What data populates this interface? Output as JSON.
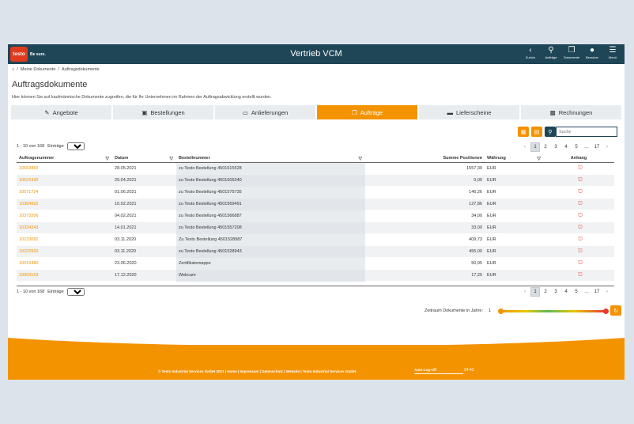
{
  "header": {
    "logo_text": "testo",
    "logo_tagline": "Be sure.",
    "title": "Vertrieb VCM",
    "actions": [
      {
        "label": "Zurück",
        "icon": "chevron-left-icon"
      },
      {
        "label": "Aufträge",
        "icon": "map-pin-icon"
      },
      {
        "label": "Dokumente",
        "icon": "documents-icon"
      },
      {
        "label": "Benutzer",
        "icon": "user-icon"
      },
      {
        "label": "Menü",
        "icon": "menu-icon"
      }
    ]
  },
  "breadcrumb": [
    "Meine Dokumente",
    "Auftragsdokumente"
  ],
  "page": {
    "title": "Auftragsdokumente",
    "intro": "Hier können Sie auf kaufmännische Dokumente zugreifen, die für Ihr Unternehmen im Rahmen der Auftragsabwicklung erstellt wurden."
  },
  "tabs": [
    {
      "label": "Angebote",
      "icon": "edit-icon",
      "active": false
    },
    {
      "label": "Bestellungen",
      "icon": "cart-icon",
      "active": false
    },
    {
      "label": "Anlieferungen",
      "icon": "inbox-icon",
      "active": false
    },
    {
      "label": "Aufträge",
      "icon": "copy-icon",
      "active": true
    },
    {
      "label": "Lieferscheine",
      "icon": "truck-icon",
      "active": false
    },
    {
      "label": "Rechnungen",
      "icon": "credit-card-icon",
      "active": false
    }
  ],
  "toolbar": {
    "search_placeholder": "Suche"
  },
  "paging": {
    "info": "1 - 10 von 168",
    "entries_label": "Einträge",
    "entries_value": "10",
    "pages": [
      "1",
      "2",
      "3",
      "4",
      "5",
      "…",
      "17"
    ],
    "current_page": "1",
    "prev": "‹",
    "next": "›"
  },
  "table": {
    "columns": [
      "Auftragsnummer",
      "Datum",
      "Bestellnummer",
      "Summe Positionen",
      "Währung",
      "Anhang"
    ],
    "rows": [
      {
        "nr": "10563883",
        "date": "28.05.2021",
        "order": "zu Testo Bestellung 4501615528",
        "sum": "1557,39",
        "cur": "EUR"
      },
      {
        "nr": "10522430",
        "date": "29.04.2021",
        "order": "zu Testo Bestellung 4501605340",
        "sum": "0,00",
        "cur": "EUR"
      },
      {
        "nr": "10571724",
        "date": "01.06.2021",
        "order": "zu Testo Bestellung 4501575735",
        "sum": "146,26",
        "cur": "EUR"
      },
      {
        "nr": "10384962",
        "date": "10.02.2021",
        "order": "zu Testo Bestellung 4501569491",
        "sum": "127,86",
        "cur": "EUR"
      },
      {
        "nr": "10373206",
        "date": "04.02.2021",
        "order": "zu Testo Bestellung 4501566887",
        "sum": "34,00",
        "cur": "EUR"
      },
      {
        "nr": "10334343",
        "date": "14.01.2021",
        "order": "zu Testo Bestellung 4501557208",
        "sum": "33,00",
        "cur": "EUR"
      },
      {
        "nr": "10223082",
        "date": "03.11.2020",
        "order": "Zu Testo Bestellung 4501528987",
        "sum": "409,73",
        "cur": "EUR"
      },
      {
        "nr": "10222920",
        "date": "03.11.2020",
        "order": "zu Testo Bestellung 4501528943",
        "sum": "455,00",
        "cur": "EUR"
      },
      {
        "nr": "10015480",
        "date": "23.06.2020",
        "order": "Zertifikatsmappe",
        "sum": "50,95",
        "cur": "EUR"
      },
      {
        "nr": "10003163",
        "date": "17.12.2020",
        "order": "Webcam",
        "sum": "17,25",
        "cur": "EUR"
      }
    ]
  },
  "range": {
    "label": "Zeitraum Dokumente in Jahre:",
    "value": "1"
  },
  "footer": {
    "links": "© Testo Industrial Services GmbH 2021 | Home | Impressum | Datenschutz | Website | Testo Industrial Services GmbH",
    "logoff_label": "Auto-Log-Off",
    "logoff_time": "24:43"
  },
  "colors": {
    "header_bg": "#1e4656",
    "accent": "#f39300",
    "logo_red": "#e03a1e"
  }
}
